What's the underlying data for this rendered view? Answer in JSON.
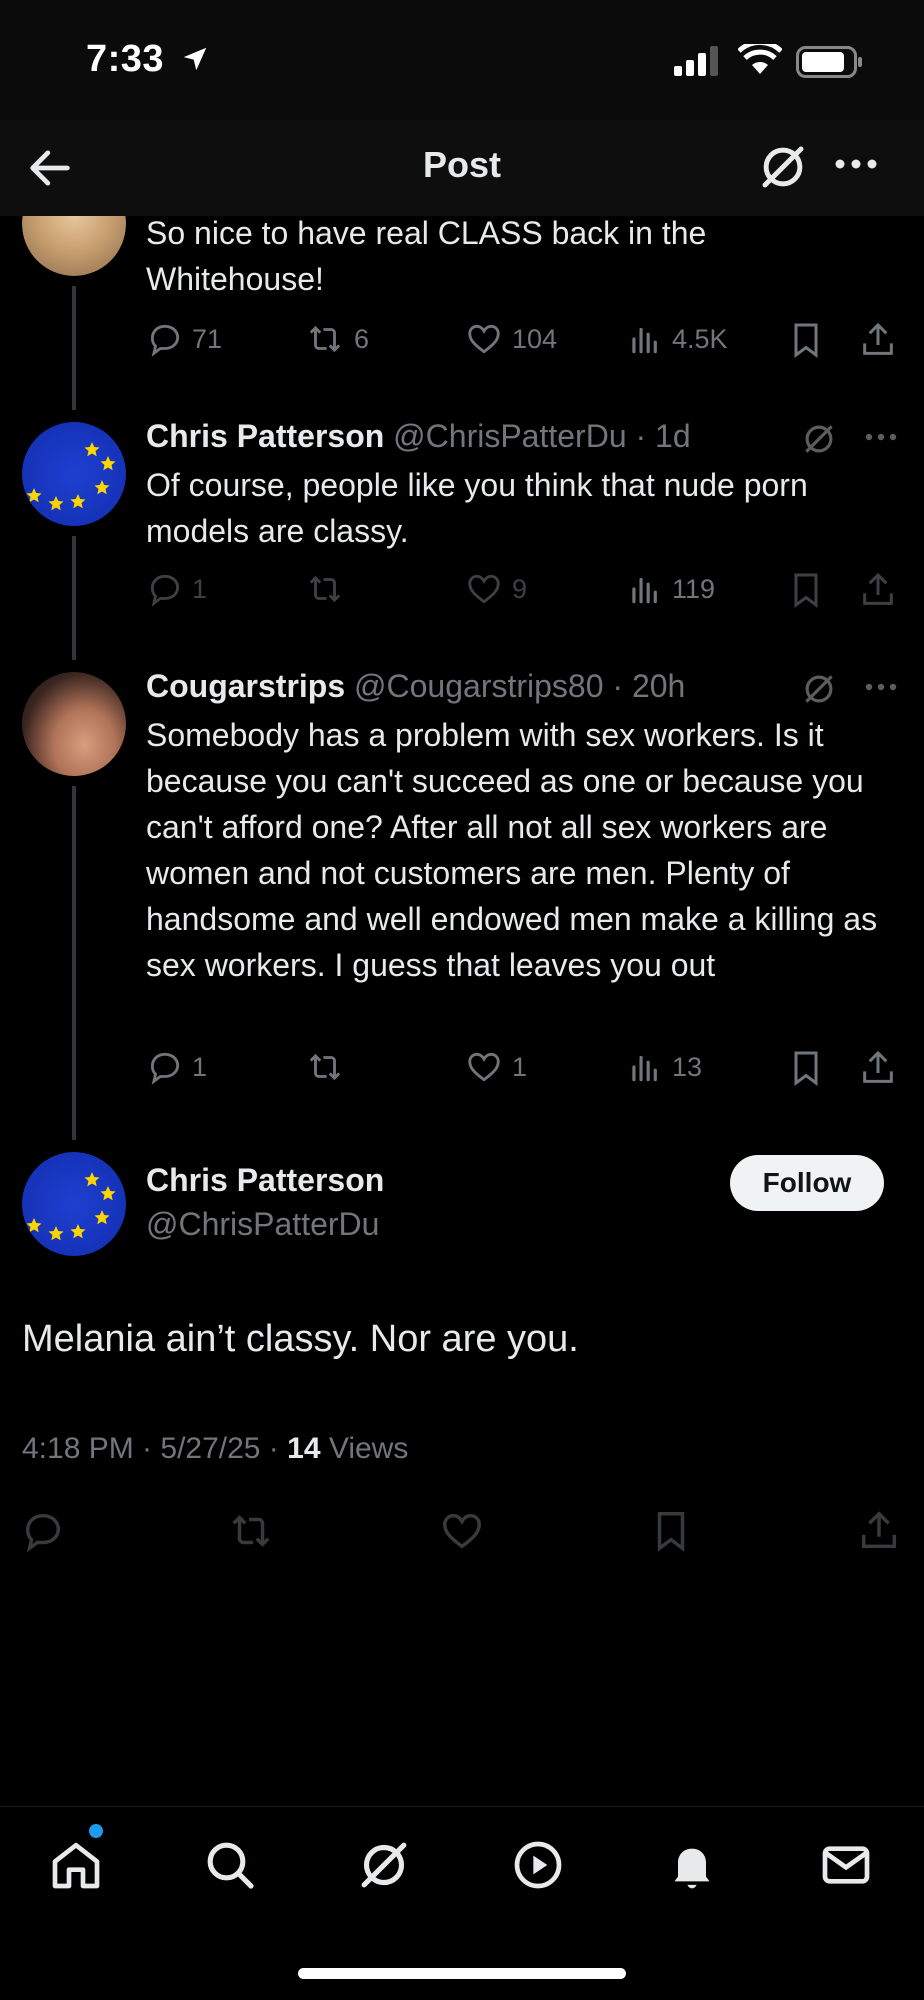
{
  "status_bar": {
    "time": "7:33"
  },
  "header": {
    "title": "Post"
  },
  "thread": [
    {
      "text": "So nice to have real CLASS back in the Whitehouse!",
      "replies": "71",
      "reposts": "6",
      "likes": "104",
      "views": "4.5K"
    },
    {
      "name": "Chris Patterson",
      "handle": "@ChrisPatterDu",
      "time": "· 1d",
      "text": "Of course, people like you think that nude porn models are classy.",
      "replies": "1",
      "reposts": "",
      "likes": "9",
      "views": "119"
    },
    {
      "name": "Cougarstrips",
      "handle": "@Cougarstrips80",
      "time": "· 20h",
      "text": "Somebody has a problem with sex workers.  Is it because you can't succeed as one or because you can't afford one? After all not all sex workers are women and not customers are men. Plenty of handsome and well endowed men make a killing as sex workers. I guess that leaves you out",
      "replies": "1",
      "reposts": "",
      "likes": "1",
      "views": "13"
    }
  ],
  "main_post": {
    "name": "Chris Patterson",
    "handle": "@ChrisPatterDu",
    "follow_label": "Follow",
    "text": "Melania ain’t classy. Nor are you.",
    "timestamp": "4:18 PM · 5/27/25 · ",
    "views_count": "14",
    "views_label": " Views"
  },
  "tabs": [
    "home-icon",
    "search-icon",
    "grok-icon",
    "video-icon",
    "notifications-icon",
    "messages-icon"
  ],
  "colors": {
    "accent": "#1d9bf0",
    "muted": "#71767b",
    "text": "#e7e9ea"
  }
}
